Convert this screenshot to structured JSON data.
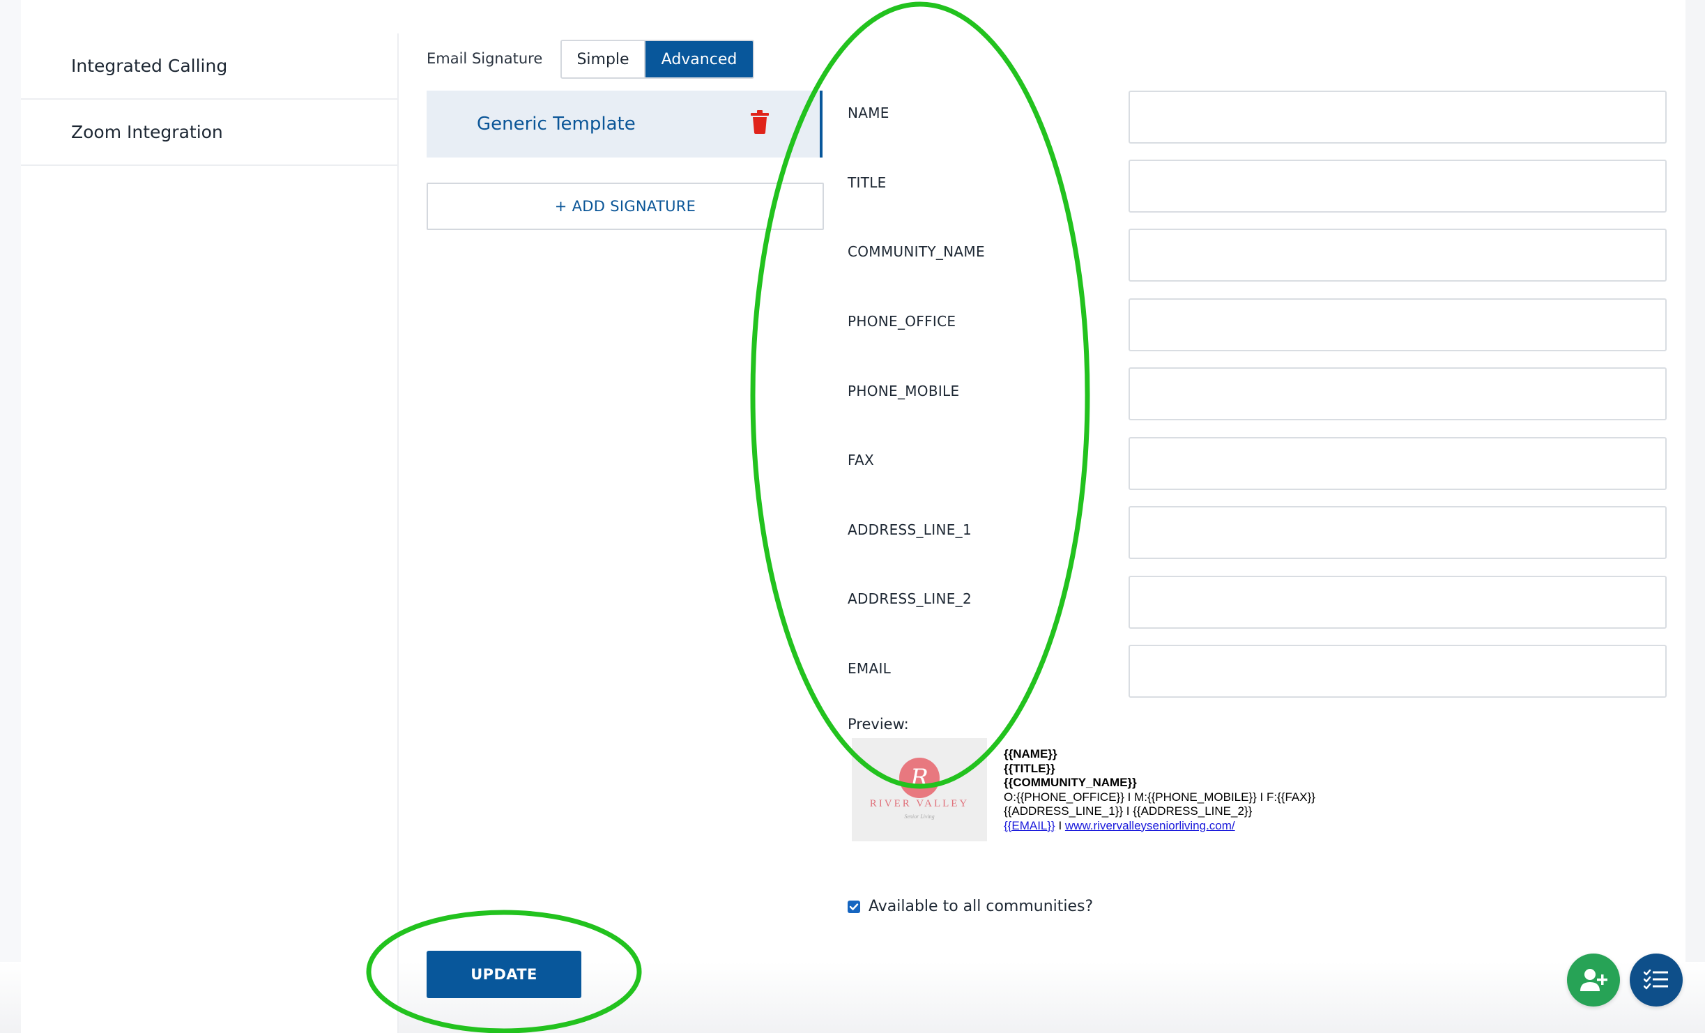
{
  "sidebar": {
    "items": [
      {
        "label": "Integrated Calling"
      },
      {
        "label": "Zoom Integration"
      }
    ]
  },
  "signature": {
    "label": "Email Signature",
    "mode_options": [
      "Simple",
      "Advanced"
    ],
    "selected_mode": "Advanced",
    "templates": [
      {
        "name": "Generic Template"
      }
    ],
    "add_label": "+ ADD SIGNATURE"
  },
  "fields": [
    {
      "label": "NAME",
      "value": ""
    },
    {
      "label": "TITLE",
      "value": ""
    },
    {
      "label": "COMMUNITY_NAME",
      "value": ""
    },
    {
      "label": "PHONE_OFFICE",
      "value": ""
    },
    {
      "label": "PHONE_MOBILE",
      "value": ""
    },
    {
      "label": "FAX",
      "value": ""
    },
    {
      "label": "ADDRESS_LINE_1",
      "value": ""
    },
    {
      "label": "ADDRESS_LINE_2",
      "value": ""
    },
    {
      "label": "EMAIL",
      "value": ""
    }
  ],
  "preview": {
    "label": "Preview:",
    "logo": {
      "monogram": "R",
      "text": "RIVER VALLEY",
      "subtext": "Senior Living"
    },
    "lines": {
      "name": "{{NAME}}",
      "title": "{{TITLE}}",
      "community": "{{COMMUNITY_NAME}}",
      "phones": "O:{{PHONE_OFFICE}} I M:{{PHONE_MOBILE}} I F:{{FAX}}",
      "address": "{{ADDRESS_LINE_1}} I {{ADDRESS_LINE_2}}",
      "email_link": "{{EMAIL}}",
      "separator": " I ",
      "website_link": "www.rivervalleyseniorliving.com/"
    }
  },
  "availability": {
    "label": "Available to all communities?",
    "checked": true
  },
  "update_label": "UPDATE",
  "fabs": [
    {
      "icon": "add-user-icon",
      "color": "#27a356"
    },
    {
      "icon": "task-list-icon",
      "color": "#0e4f8a"
    }
  ],
  "colors": {
    "primary": "#08579b",
    "annotation": "#22c21e",
    "danger": "#e0231a"
  }
}
